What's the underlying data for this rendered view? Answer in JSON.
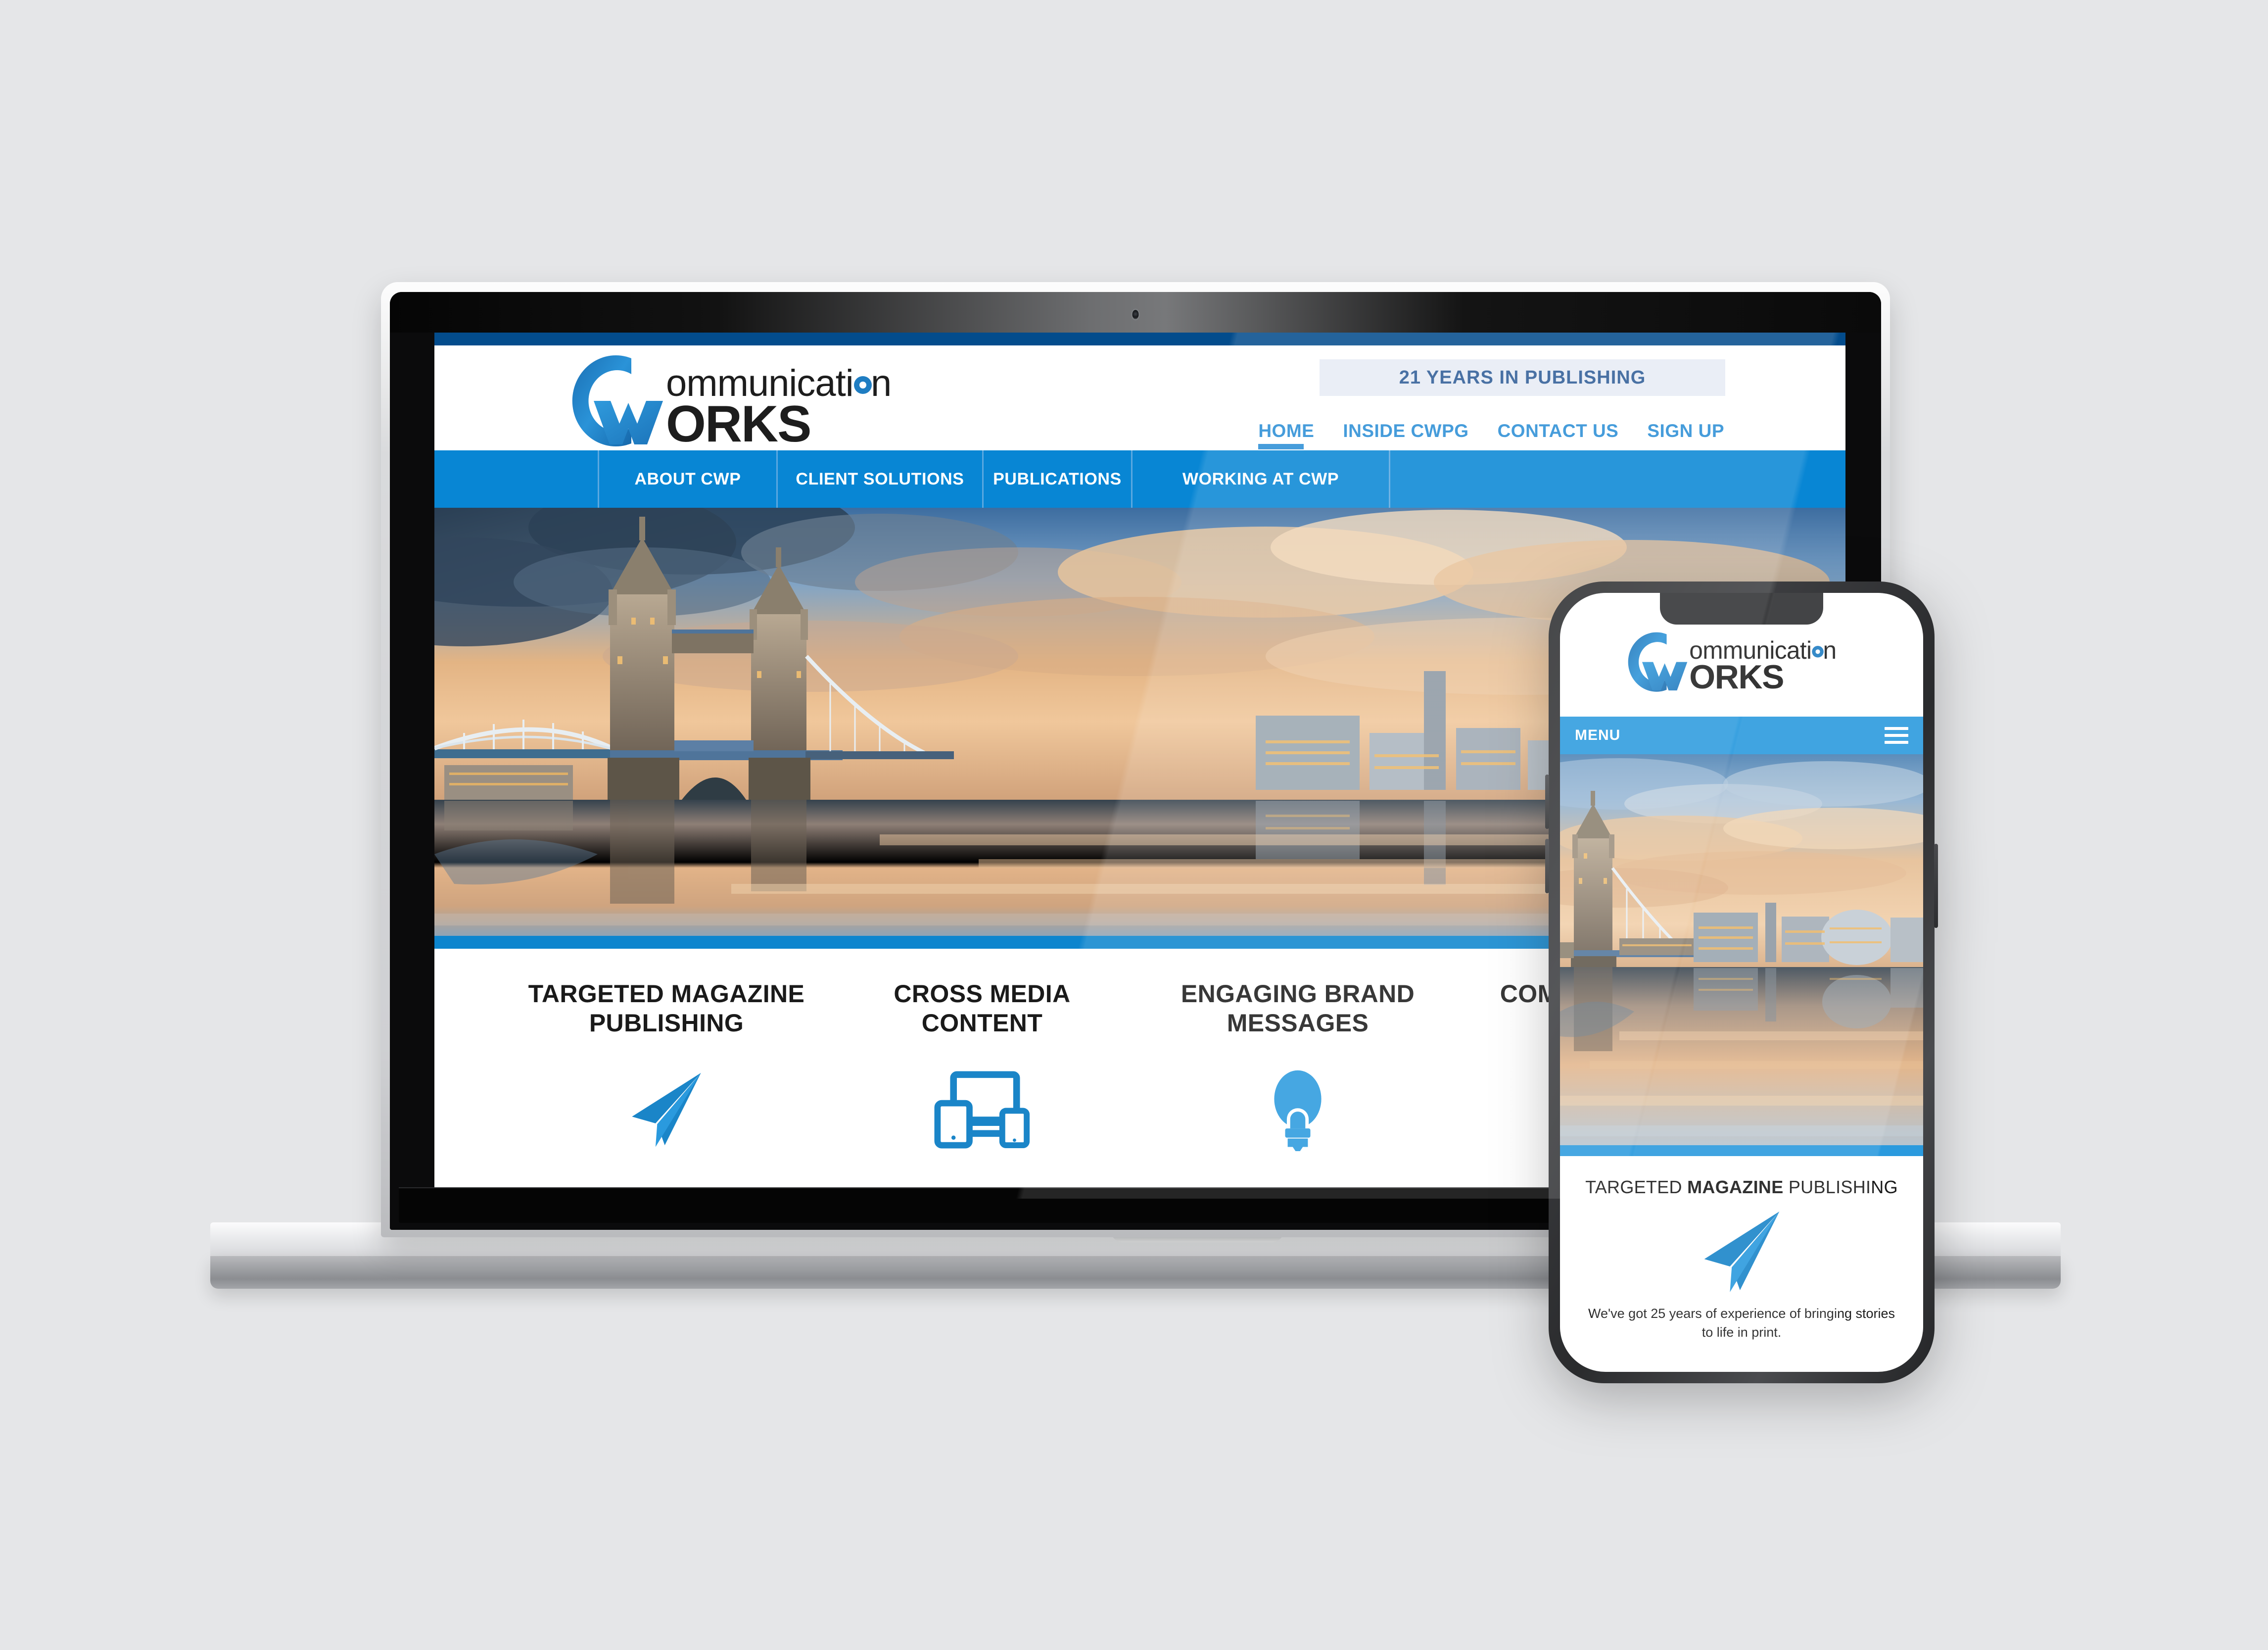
{
  "brand": {
    "logo_line1": "ommunication",
    "logo_line2": "ORKS",
    "logo_initial": "C",
    "logo_w": "W",
    "accent_color": "#0886d4",
    "dark_blue": "#034c8c"
  },
  "desktop": {
    "badge": "21 YEARS IN PUBLISHING",
    "top_links": [
      {
        "label": "HOME",
        "active": true
      },
      {
        "label": "INSIDE CWPG",
        "active": false
      },
      {
        "label": "CONTACT US",
        "active": false
      },
      {
        "label": "SIGN UP",
        "active": false
      }
    ],
    "main_nav": [
      {
        "label": "ABOUT CWP"
      },
      {
        "label": "CLIENT SOLUTIONS"
      },
      {
        "label": "PUBLICATIONS"
      },
      {
        "label": "WORKING AT CWP"
      }
    ],
    "hero_alt": "Tower Bridge London at sunset reflected in the Thames",
    "features": [
      {
        "title": "TARGETED MAGAZINE PUBLISHING",
        "icon": "paper-plane-icon"
      },
      {
        "title": "CROSS MEDIA CONTENT",
        "icon": "devices-icon"
      },
      {
        "title": "ENGAGING BRAND MESSAGES",
        "icon": "lightbulb-icon"
      },
      {
        "title": "COMPLETE MEDIA PLANNING",
        "icon": "gears-icon"
      }
    ]
  },
  "phone": {
    "menu_label": "MENU",
    "menu_icon": "hamburger-icon",
    "hero_alt": "Tower Bridge London at sunset reflected in the Thames",
    "card": {
      "title_light": "TARGETED ",
      "title_bold": "MAGAZINE",
      "title_tail": " PUBLISHING",
      "icon": "paper-plane-icon",
      "body": "We've got 25 years of experience of bringing stories to life in print."
    }
  }
}
